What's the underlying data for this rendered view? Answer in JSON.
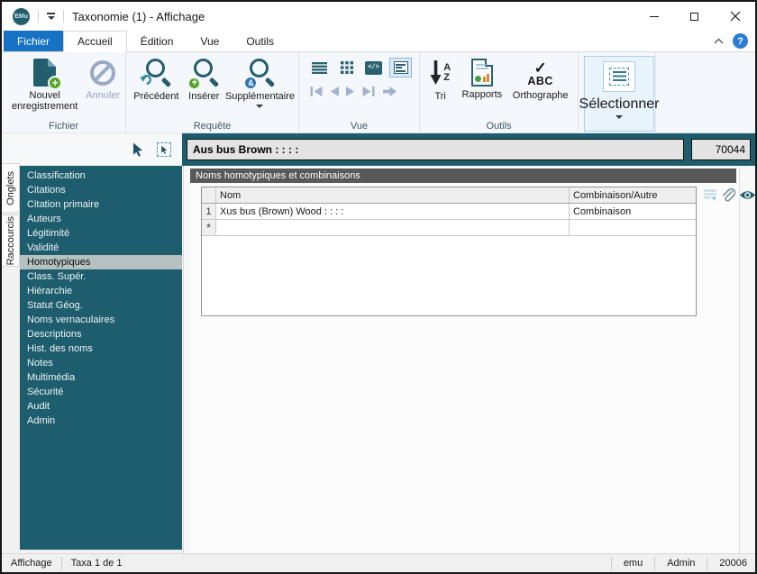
{
  "window": {
    "title": "Taxonomie (1) - Affichage",
    "logo_text": "EMu",
    "help_label": "?"
  },
  "tabs": {
    "file": "Fichier",
    "home": "Accueil",
    "edit": "Édition",
    "view": "Vue",
    "tools": "Outils"
  },
  "ribbon": {
    "fichier": {
      "label": "Fichier",
      "new_record": "Nouvel enregistrement",
      "cancel": "Annuler"
    },
    "requete": {
      "label": "Requête",
      "previous": "Précédent",
      "insert": "Insérer",
      "supplementary": "Supplémentaire"
    },
    "vue": {
      "label": "Vue"
    },
    "outils": {
      "label": "Outils",
      "sort": "Tri",
      "reports": "Rapports",
      "spelling": "Orthographe"
    },
    "select": {
      "label": "Sélectionner"
    },
    "icons": {
      "code_glyph": "</>",
      "sort_a": "A",
      "sort_z": "Z",
      "spell_check": "✓",
      "spell_text": "ABC",
      "and_badge": "&",
      "plus_badge": "+"
    }
  },
  "record": {
    "name": "Aus bus Brown : : : :",
    "number": "70044"
  },
  "side_tabs": {
    "onglets": "Onglets",
    "raccourcis": "Raccourcis"
  },
  "sidebar": {
    "selected": "Homotypiques",
    "items": [
      "Classification",
      "Citations",
      "Citation primaire",
      "Auteurs",
      "Légitimité",
      "Validité",
      "Homotypiques",
      "Class. Supér.",
      "Hiérarchie",
      "Statut Géog.",
      "Noms vernaculaires",
      "Descriptions",
      "Hist. des noms",
      "Notes",
      "Multimédia",
      "Sécurité",
      "Audit",
      "Admin"
    ]
  },
  "panel": {
    "header": "Noms homotypiques et combinaisons",
    "table": {
      "columns": [
        "Nom",
        "Combinaison/Autre"
      ],
      "rows": [
        {
          "num": "1",
          "nom": "Xus bus (Brown) Wood : : : :",
          "combinaison": "Combinaison"
        },
        {
          "num": "*",
          "nom": "",
          "combinaison": ""
        }
      ]
    }
  },
  "statusbar": {
    "mode": "Affichage",
    "count": "Taxa 1 de 1",
    "right": [
      "emu",
      "Admin",
      "20006"
    ]
  },
  "colors": {
    "accent_teal": "#1E5D6D",
    "file_tab_blue": "#1673C4",
    "help_blue": "#2D7DD2",
    "panel_header_gray": "#595959",
    "selected_item": "#B5C1C0",
    "disabled_blue_gray": "#9AA9C6"
  }
}
